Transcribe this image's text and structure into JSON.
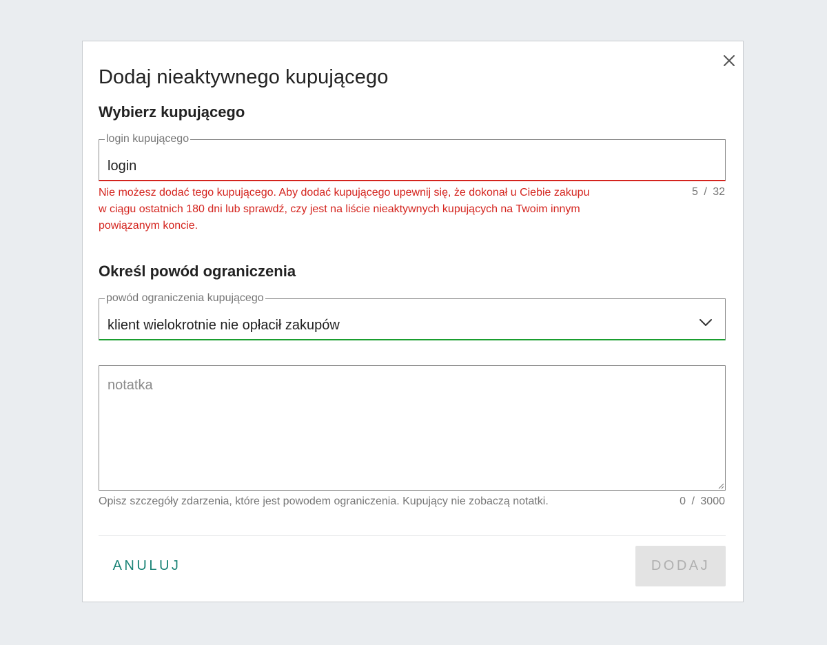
{
  "dialog": {
    "title": "Dodaj nieaktywnego kupującego",
    "close_icon": "close-icon"
  },
  "buyer_section": {
    "title": "Wybierz kupującego",
    "login_field": {
      "label": "login kupującego",
      "value": "login",
      "state": "error",
      "error_message": "Nie możesz dodać tego kupującego. Aby dodać kupującego upewnij się, że dokonał u Ciebie zakupu w ciągu ostatnich 180 dni lub sprawdź, czy jest na liście nieaktywnych kupujących na Twoim innym powiązanym koncie.",
      "counter": "5 / 32"
    }
  },
  "reason_section": {
    "title": "Określ powód ograniczenia",
    "reason_select": {
      "label": "powód ograniczenia kupującego",
      "selected": "klient wielokrotnie nie opłacił zakupów",
      "icon": "chevron-down-icon"
    },
    "note": {
      "placeholder": "notatka",
      "value": "",
      "helper": "Opisz szczegóły zdarzenia, które jest powodem ograniczenia. Kupujący nie zobaczą notatki.",
      "counter": "0 / 3000"
    }
  },
  "actions": {
    "cancel_label": "ANULUJ",
    "add_label": "DODAJ",
    "add_disabled": true
  },
  "colors": {
    "page_background": "#eaedf0",
    "error": "#d4241e",
    "success": "#1a9e2f",
    "accent": "#1a8376",
    "disabled_bg": "#e3e3e3",
    "disabled_text": "#b0b0b0"
  }
}
